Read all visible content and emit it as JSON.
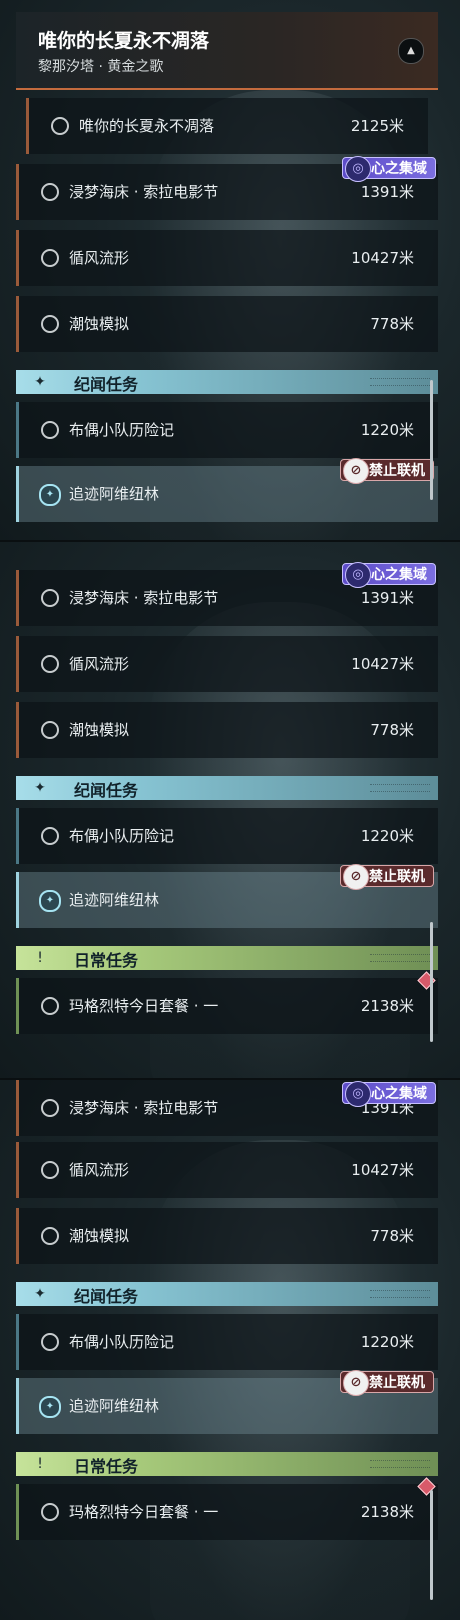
{
  "header": {
    "title": "唯你的长夏永不凋落",
    "subtitle": "黎那汐塔 · 黄金之歌",
    "collapse_icon": "chevron-up-icon"
  },
  "quests": {
    "current_step": {
      "label": "唯你的长夏永不凋落",
      "distance": "2125米"
    },
    "dream": {
      "label": "浸梦海床 · 索拉电影节",
      "distance": "1391米"
    },
    "wind": {
      "label": "循风流形",
      "distance": "10427米"
    },
    "erosion": {
      "label": "潮蚀模拟",
      "distance": "778米"
    },
    "doll": {
      "label": "布偶小队历险记",
      "distance": "1220米"
    },
    "trace": {
      "label": "追迹阿维纽林"
    },
    "daily": {
      "label": "玛格烈特今日套餐 · 一",
      "distance": "2138米"
    }
  },
  "badges": {
    "realm": "心之集域",
    "no_online": "禁止联机"
  },
  "sections": {
    "chronicle": "纪闻任务",
    "daily": "日常任务"
  },
  "colors": {
    "orange_accent": "#c46b3e",
    "cyan_section": "#a7dde9",
    "green_section": "#c6e39a",
    "realm_badge": "#6b5cd6",
    "no_online_badge": "#5a2a2c"
  }
}
